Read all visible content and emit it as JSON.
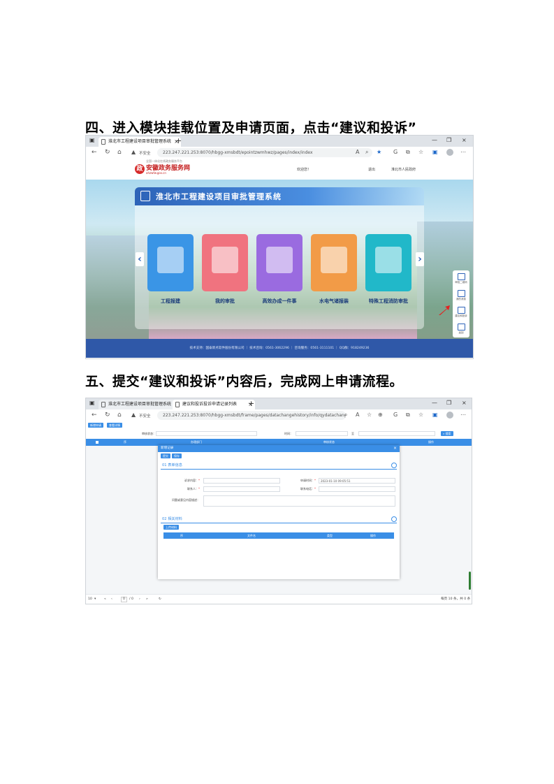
{
  "headings": {
    "step4": "四、进入模块挂载位置及申请页面，点击“建议和投诉”",
    "step5": "五、提交“建议和投诉”内容后，完成网上申请流程。"
  },
  "screenshot1": {
    "tab_title": "淮北市工程建设项目审批管理系统",
    "security": "不安全",
    "url": "223.247.221.253:8070/hbgg-xmsbdt/epointzwmhwz/pages/index/index",
    "logo": {
      "name": "安徽政务服务网",
      "tagline": "全国一体化在线政务服务平台",
      "domain": "ahzwfw.gov.cn"
    },
    "header": {
      "welcome": "欢迎您！",
      "logout": "退出",
      "gov": "淮北市人民政府"
    },
    "system_title": "淮北市工程建设项目审批管理系统",
    "cards": [
      {
        "label": "工程报建",
        "color": "#3a95e6"
      },
      {
        "label": "我的审批",
        "color": "#f0737f"
      },
      {
        "label": "高效办成一件事",
        "color": "#9a6be0"
      },
      {
        "label": "水电气诸报装",
        "color": "#f29b47"
      },
      {
        "label": "特殊工程消防审批",
        "color": "#21b8c9"
      }
    ],
    "sidebar": [
      "审批二维码",
      "我的消息",
      "建议和投诉",
      "返回"
    ],
    "footer": "技术支持：国泰新点软件股份有限公司 ｜ 技术咨询：0561-3062296 ｜ 咨询服务：0561-3111101 ｜ QQ群：918249236"
  },
  "screenshot2": {
    "tabs": [
      "淮北市工程建设项目审批管理系统",
      "建议和投诉投诉申请记录列表"
    ],
    "security": "不安全",
    "url": "223.247.221.253:8070/hbgg-xmsbdt/frame/pages/datachangehistory/info/qydatachangehistor...",
    "toolbar": [
      "新增申请",
      "查看详情"
    ],
    "filter": {
      "status_label": "审核状态：",
      "date_label": "时间：",
      "to": "至",
      "search": "搜索"
    },
    "table_header": [
      "序",
      "办理部门",
      "审核状态",
      "操作"
    ],
    "dialog": {
      "title": "新增记录",
      "buttons": [
        "提交",
        "保存"
      ],
      "section1": "01 表单信息",
      "fields": {
        "item_label": "诉求内容：",
        "date_label": "申请时间：",
        "date_value": "2023-01-10 09:05:51",
        "person_label": "联系人：",
        "phone_label": "联系电话：",
        "content_label": "问题或意见内容描述："
      },
      "section2": "02 相关材料",
      "upload": "上传材料",
      "files_header": [
        "序",
        "文件名",
        "类型",
        "操作"
      ]
    },
    "pager": {
      "size": "10",
      "page": "0",
      "total": "/ 0",
      "info": "每页 10 条，共 0 条"
    }
  }
}
